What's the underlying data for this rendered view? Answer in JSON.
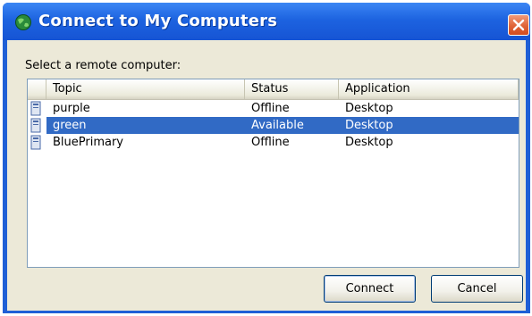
{
  "window": {
    "title": "Connect to My Computers",
    "close_icon": "close-icon"
  },
  "prompt": "Select a remote computer:",
  "list": {
    "columns": [
      "",
      "Topic",
      "Status",
      "Application"
    ],
    "rows": [
      {
        "icon": "computer-icon",
        "topic": "purple",
        "status": "Offline",
        "application": "Desktop",
        "selected": false
      },
      {
        "icon": "computer-icon",
        "topic": "green",
        "status": "Available",
        "application": "Desktop",
        "selected": true
      },
      {
        "icon": "computer-icon",
        "topic": "BluePrimary",
        "status": "Offline",
        "application": "Desktop",
        "selected": false
      }
    ]
  },
  "buttons": {
    "connect": "Connect",
    "cancel": "Cancel"
  },
  "colors": {
    "titlebar": "#1f5fd6",
    "selection": "#316ac5",
    "dialog_background": "#ece9d8",
    "close_button": "#e06437"
  }
}
